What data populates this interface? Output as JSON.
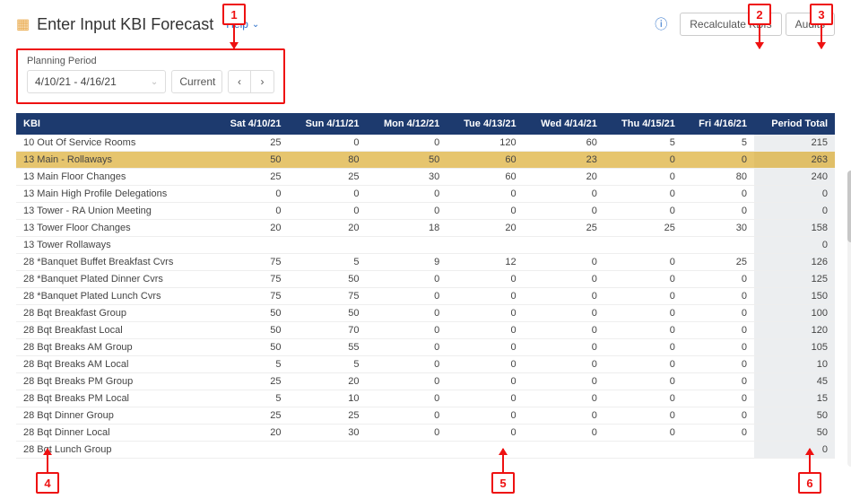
{
  "header": {
    "title": "Enter Input KBI Forecast",
    "help_label": "Help",
    "recalc_label": "Recalculate KBIs",
    "audits_label": "Audits"
  },
  "planning": {
    "label": "Planning Period",
    "range": "4/10/21 - 4/16/21",
    "current_label": "Current"
  },
  "columns": {
    "kbi": "KBI",
    "days": [
      "Sat 4/10/21",
      "Sun 4/11/21",
      "Mon 4/12/21",
      "Tue 4/13/21",
      "Wed 4/14/21",
      "Thu 4/15/21",
      "Fri 4/16/21"
    ],
    "total": "Period Total"
  },
  "rows": [
    {
      "name": "10 Out Of Service Rooms",
      "v": [
        "25",
        "0",
        "0",
        "120",
        "60",
        "5",
        "5"
      ],
      "total": "215"
    },
    {
      "name": "13 Main - Rollaways",
      "v": [
        "50",
        "80",
        "50",
        "60",
        "23",
        "0",
        "0"
      ],
      "total": "263",
      "hl": true
    },
    {
      "name": "13 Main Floor Changes",
      "v": [
        "25",
        "25",
        "30",
        "60",
        "20",
        "0",
        "80"
      ],
      "total": "240"
    },
    {
      "name": "13 Main High Profile Delegations",
      "v": [
        "0",
        "0",
        "0",
        "0",
        "0",
        "0",
        "0"
      ],
      "total": "0"
    },
    {
      "name": "13 Tower - RA Union Meeting",
      "v": [
        "0",
        "0",
        "0",
        "0",
        "0",
        "0",
        "0"
      ],
      "total": "0"
    },
    {
      "name": "13 Tower Floor Changes",
      "v": [
        "20",
        "20",
        "18",
        "20",
        "25",
        "25",
        "30"
      ],
      "total": "158"
    },
    {
      "name": "13 Tower Rollaways",
      "v": [
        "",
        "",
        "",
        "",
        "",
        "",
        ""
      ],
      "total": "0"
    },
    {
      "name": "28 *Banquet Buffet Breakfast Cvrs",
      "v": [
        "75",
        "5",
        "9",
        "12",
        "0",
        "0",
        "25"
      ],
      "total": "126"
    },
    {
      "name": "28 *Banquet Plated Dinner Cvrs",
      "v": [
        "75",
        "50",
        "0",
        "0",
        "0",
        "0",
        "0"
      ],
      "total": "125"
    },
    {
      "name": "28 *Banquet Plated Lunch Cvrs",
      "v": [
        "75",
        "75",
        "0",
        "0",
        "0",
        "0",
        "0"
      ],
      "total": "150"
    },
    {
      "name": "28 Bqt Breakfast Group",
      "v": [
        "50",
        "50",
        "0",
        "0",
        "0",
        "0",
        "0"
      ],
      "total": "100"
    },
    {
      "name": "28 Bqt Breakfast Local",
      "v": [
        "50",
        "70",
        "0",
        "0",
        "0",
        "0",
        "0"
      ],
      "total": "120"
    },
    {
      "name": "28 Bqt Breaks AM Group",
      "v": [
        "50",
        "55",
        "0",
        "0",
        "0",
        "0",
        "0"
      ],
      "total": "105"
    },
    {
      "name": "28 Bqt Breaks AM Local",
      "v": [
        "5",
        "5",
        "0",
        "0",
        "0",
        "0",
        "0"
      ],
      "total": "10"
    },
    {
      "name": "28 Bqt Breaks PM Group",
      "v": [
        "25",
        "20",
        "0",
        "0",
        "0",
        "0",
        "0"
      ],
      "total": "45"
    },
    {
      "name": "28 Bqt Breaks PM Local",
      "v": [
        "5",
        "10",
        "0",
        "0",
        "0",
        "0",
        "0"
      ],
      "total": "15"
    },
    {
      "name": "28 Bqt Dinner Group",
      "v": [
        "25",
        "25",
        "0",
        "0",
        "0",
        "0",
        "0"
      ],
      "total": "50"
    },
    {
      "name": "28 Bqt Dinner Local",
      "v": [
        "20",
        "30",
        "0",
        "0",
        "0",
        "0",
        "0"
      ],
      "total": "50"
    },
    {
      "name": "28 Bqt Lunch Group",
      "v": [
        "",
        "",
        "",
        "",
        "",
        "",
        ""
      ],
      "total": "0"
    }
  ],
  "callouts": {
    "1": "1",
    "2": "2",
    "3": "3",
    "4": "4",
    "5": "5",
    "6": "6"
  }
}
